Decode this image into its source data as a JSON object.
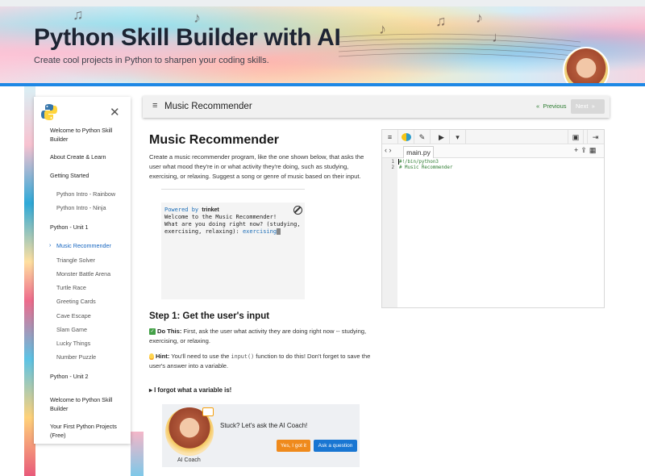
{
  "banner": {
    "title": "Python Skill Builder with AI",
    "subtitle": "Create cool projects in Python to sharpen your coding skills."
  },
  "sidebar": {
    "items": [
      {
        "label": "Welcome to Python Skill Builder",
        "type": "section"
      },
      {
        "label": "About Create & Learn",
        "type": "section"
      },
      {
        "label": "Getting Started",
        "type": "section"
      },
      {
        "label": "Python Intro - Rainbow",
        "type": "lesson"
      },
      {
        "label": "Python Intro - Ninja",
        "type": "lesson"
      },
      {
        "label": "Python - Unit 1",
        "type": "section"
      },
      {
        "label": "Music Recommender",
        "type": "lesson",
        "active": true
      },
      {
        "label": "Triangle Solver",
        "type": "lesson"
      },
      {
        "label": "Monster Battle Arena",
        "type": "lesson"
      },
      {
        "label": "Turtle Race",
        "type": "lesson"
      },
      {
        "label": "Greeting Cards",
        "type": "lesson"
      },
      {
        "label": "Cave Escape",
        "type": "lesson"
      },
      {
        "label": "Slam Game",
        "type": "lesson"
      },
      {
        "label": "Lucky Things",
        "type": "lesson"
      },
      {
        "label": "Number Puzzle",
        "type": "lesson"
      },
      {
        "label": "Python - Unit 2",
        "type": "section"
      },
      {
        "label": "Welcome to Python Skill Builder",
        "type": "section"
      },
      {
        "label": "Your First Python Projects (Free)",
        "type": "section"
      }
    ]
  },
  "header": {
    "title": "Music Recommender",
    "previous_label": "Previous",
    "next_label": "Next"
  },
  "content": {
    "title": "Music Recommender",
    "intro": "Create a music recommender program, like the one shown below, that asks the user what mood they're in or what activity they're doing, such as studying, exercising, or relaxing. Suggest a song or genre of music based on their input.",
    "terminal": {
      "powered_by": "Powered by",
      "brand": "trinket",
      "line1": "Welcome to the Music Recommender!",
      "line2": "What are you doing right now? (studying,",
      "line3_prefix": "exercising, relaxing): ",
      "line3_input": "exercising"
    },
    "step1_title": "Step 1: Get the user's input",
    "do_this_label": "Do This:",
    "do_this_text": "First, ask the user what activity they are doing right now -- studying, exercising, or relaxing.",
    "hint_label": "Hint:",
    "hint_text_1": "You'll need to use the",
    "hint_code": "input()",
    "hint_text_2": "function to do this! Don't forget to save the user's answer into a variable.",
    "details_label": "I forgot what a variable is!"
  },
  "coach": {
    "name": "AI Coach",
    "question": "Stuck? Let's ask the AI Coach!",
    "yes_label": "Yes, I got it",
    "ask_label": "Ask a question"
  },
  "editor": {
    "file_tab": "main.py",
    "lines": [
      {
        "num": "1",
        "code": "#!/bin/python3"
      },
      {
        "num": "2",
        "code": "# Music Recommender"
      }
    ]
  },
  "colors": {
    "accent_blue": "#1e88e5",
    "active_link": "#1565c0",
    "coach_yes": "#ef8a1c",
    "coach_ask": "#1976d2",
    "code_comment": "#2e7d32"
  }
}
